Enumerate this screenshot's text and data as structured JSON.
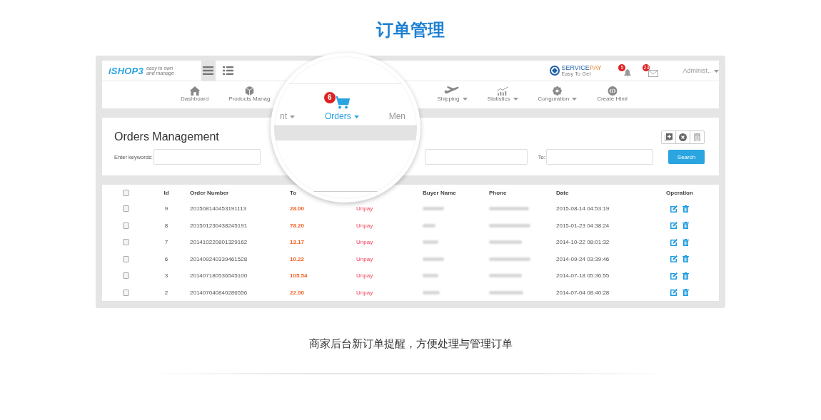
{
  "heading": "订单管理",
  "topbar": {
    "logo": "iSHOP3",
    "tagline": [
      "easy to own",
      "and manage"
    ],
    "view_toggle": [
      {
        "selected": true
      },
      {
        "selected": false
      }
    ],
    "service_logo": {
      "name": "SERVICE",
      "name_accent": "PAY",
      "slogan": "Easy To Get"
    },
    "notifications": "5",
    "messages": "23",
    "user": "Administ.."
  },
  "nav": {
    "items": [
      {
        "label": "Dashboard",
        "dropdown": false
      },
      {
        "label": "Products Manag",
        "dropdown": false
      },
      {
        "label": "Shipping",
        "dropdown": true
      },
      {
        "label": "Statistics",
        "dropdown": true
      },
      {
        "label": "Conguration",
        "dropdown": true
      },
      {
        "label": "Create Html",
        "dropdown": false
      }
    ]
  },
  "magnifier": {
    "items": [
      {
        "label": "nt",
        "dropdown": true,
        "selected": false
      },
      {
        "label": "Orders",
        "dropdown": true,
        "selected": true,
        "badge": "6"
      },
      {
        "label": "Men",
        "dropdown": false,
        "selected": false
      }
    ]
  },
  "panel": {
    "title": "Orders Management",
    "fields": [
      {
        "label": "Enter keywords:"
      },
      {
        "label": "To:"
      }
    ],
    "search_button": "Search"
  },
  "table": {
    "select_all": {
      "checked": false
    },
    "columns": [
      "Id",
      "Order Number",
      "To",
      "Buyer Name",
      "Phone",
      "Date",
      "Operation"
    ],
    "rows": [
      {
        "checked": false,
        "id": "9",
        "order_number": "201508140453191113",
        "total": "28.00",
        "status": "Unpay",
        "date": "2015-08-14 04:53:19"
      },
      {
        "checked": false,
        "id": "8",
        "order_number": "201501230438245191",
        "total": "78.20",
        "status": "Unpay",
        "date": "2015-01-23 04:38:24"
      },
      {
        "checked": false,
        "id": "7",
        "order_number": "201410220801329162",
        "total": "13.17",
        "status": "Unpay",
        "date": "2014-10-22 08:01:32"
      },
      {
        "checked": false,
        "id": "6",
        "order_number": "201409240339461528",
        "total": "10.22",
        "status": "Unpay",
        "date": "2014-09-24 03:39:46"
      },
      {
        "checked": false,
        "id": "3",
        "order_number": "201407180536545100",
        "total": "105.54",
        "status": "Unpay",
        "date": "2014-07-18 05:36:55"
      },
      {
        "checked": false,
        "id": "2",
        "order_number": "201407040840286556",
        "total": "22.00",
        "status": "Unpay",
        "date": "2014-07-04 08:40:28"
      }
    ]
  },
  "caption": "商家后台新订单提醒，方便处理与管理订单"
}
